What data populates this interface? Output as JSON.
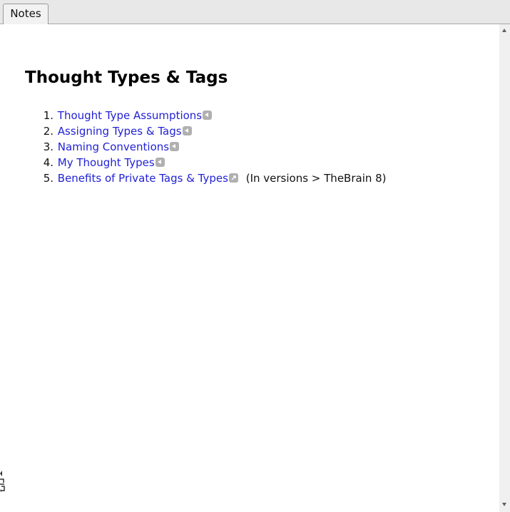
{
  "tabs": [
    {
      "label": "Notes"
    }
  ],
  "note": {
    "title": "Thought Types & Tags",
    "items": [
      {
        "number": "1.",
        "label": "Thought Type Assumptions",
        "icon": "back-link-icon"
      },
      {
        "number": "2.",
        "label": "Assigning Types & Tags",
        "icon": "back-link-icon"
      },
      {
        "number": "3.",
        "label": "Naming Conventions",
        "icon": "back-link-icon"
      },
      {
        "number": "4.",
        "label": "My Thought Types",
        "icon": "back-link-icon"
      },
      {
        "number": "5.",
        "label": "Benefits of Private Tags & Types",
        "icon": "external-link-icon",
        "suffix": "(In versions > TheBrain 8)"
      }
    ]
  },
  "colors": {
    "link": "#2222d6",
    "badge": "#b0b0b0",
    "tabbar": "#e8e8e8"
  }
}
